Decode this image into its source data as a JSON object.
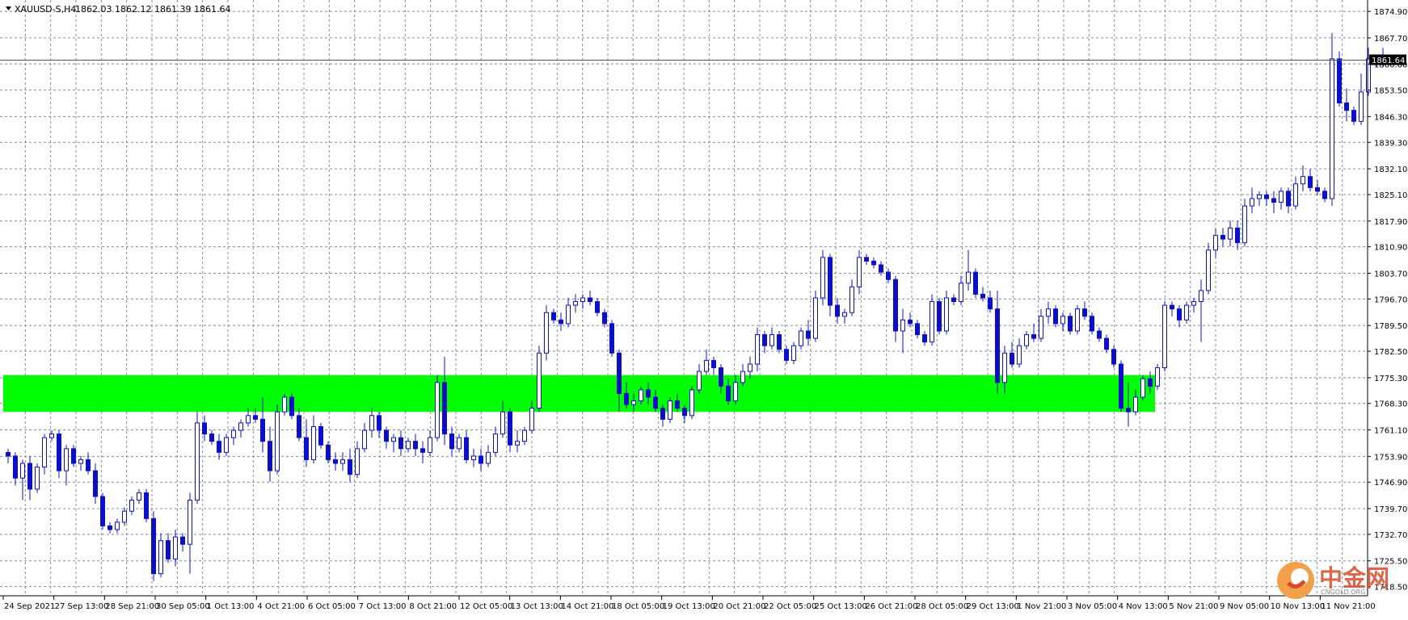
{
  "chart_header": {
    "symbol": "XAUUSD-S,H4",
    "ohlc": "1862.03 1862.12 1861.39 1861.64"
  },
  "price_axis": {
    "labels": [
      "1874.90",
      "1867.70",
      "1860.60",
      "1853.50",
      "1846.30",
      "1839.30",
      "1832.10",
      "1825.10",
      "1817.90",
      "1810.90",
      "1803.70",
      "1796.70",
      "1789.50",
      "1782.50",
      "1775.30",
      "1768.30",
      "1761.10",
      "1753.90",
      "1746.90",
      "1739.70",
      "1732.70",
      "1725.50",
      "1718.50"
    ],
    "current_price": "1861.64"
  },
  "time_axis": {
    "labels": [
      "24 Sep 2021",
      "27 Sep 13:00",
      "28 Sep 21:00",
      "30 Sep 05:00",
      "1 Oct 13:00",
      "4 Oct 21:00",
      "6 Oct 05:00",
      "7 Oct 13:00",
      "8 Oct 21:00",
      "12 Oct 05:00",
      "13 Oct 13:00",
      "14 Oct 21:00",
      "18 Oct 05:00",
      "19 Oct 13:00",
      "20 Oct 21:00",
      "22 Oct 05:00",
      "25 Oct 13:00",
      "26 Oct 21:00",
      "28 Oct 05:00",
      "29 Oct 13:00",
      "1 Nov 21:00",
      "3 Nov 05:00",
      "4 Nov 13:00",
      "5 Nov 21:00",
      "9 Nov 05:00",
      "10 Nov 13:00",
      "11 Nov 21:00"
    ]
  },
  "watermark": {
    "brand": "中金网",
    "url": "CNGOLD.ORG"
  },
  "colors": {
    "background": "#ffffff",
    "candle": "#0b10c8",
    "grid": "#7f8ca0",
    "zone": "#00ff00",
    "axis_text": "#000000",
    "watermark_orange": "#f2a14a",
    "watermark_red": "#d64a2c"
  },
  "chart_data": {
    "type": "candlestick",
    "symbol": "XAUUSD-S",
    "timeframe": "H4",
    "ylim": [
      1716,
      1878
    ],
    "highlight_zone": [
      1766,
      1776
    ],
    "ohlc": [
      [
        1755,
        1756,
        1752,
        1754
      ],
      [
        1754,
        1755,
        1746,
        1748
      ],
      [
        1748,
        1753,
        1742,
        1752
      ],
      [
        1752,
        1754,
        1742,
        1745
      ],
      [
        1745,
        1752,
        1744,
        1751
      ],
      [
        1751,
        1760,
        1749,
        1759
      ],
      [
        1759,
        1761,
        1758,
        1760
      ],
      [
        1760,
        1761,
        1748,
        1750
      ],
      [
        1750,
        1757,
        1746,
        1756
      ],
      [
        1756,
        1757,
        1751,
        1752
      ],
      [
        1752,
        1754,
        1750,
        1753
      ],
      [
        1753,
        1755,
        1749,
        1750
      ],
      [
        1750,
        1752,
        1741,
        1743
      ],
      [
        1743,
        1744,
        1734,
        1735
      ],
      [
        1735,
        1736,
        1733,
        1734
      ],
      [
        1734,
        1737,
        1733,
        1736
      ],
      [
        1736,
        1740,
        1735,
        1739
      ],
      [
        1739,
        1743,
        1738,
        1742
      ],
      [
        1742,
        1745,
        1741,
        1744
      ],
      [
        1744,
        1745,
        1736,
        1737
      ],
      [
        1737,
        1739,
        1720,
        1722
      ],
      [
        1722,
        1733,
        1721,
        1731
      ],
      [
        1731,
        1733,
        1725,
        1726
      ],
      [
        1726,
        1734,
        1724,
        1732
      ],
      [
        1732,
        1733,
        1728,
        1730
      ],
      [
        1730,
        1744,
        1722,
        1742
      ],
      [
        1742,
        1766,
        1741,
        1763
      ],
      [
        1763,
        1765,
        1758,
        1760
      ],
      [
        1760,
        1761,
        1757,
        1758
      ],
      [
        1758,
        1760,
        1753,
        1755
      ],
      [
        1755,
        1760,
        1754,
        1759
      ],
      [
        1759,
        1762,
        1757,
        1761
      ],
      [
        1761,
        1764,
        1759,
        1763
      ],
      [
        1763,
        1767,
        1762,
        1765
      ],
      [
        1765,
        1767,
        1763,
        1764
      ],
      [
        1764,
        1770,
        1755,
        1758
      ],
      [
        1758,
        1762,
        1747,
        1750
      ],
      [
        1750,
        1768,
        1749,
        1766
      ],
      [
        1766,
        1771,
        1765,
        1770
      ],
      [
        1770,
        1771,
        1764,
        1765
      ],
      [
        1765,
        1767,
        1758,
        1759
      ],
      [
        1759,
        1764,
        1751,
        1753
      ],
      [
        1753,
        1765,
        1752,
        1762
      ],
      [
        1762,
        1763,
        1756,
        1757
      ],
      [
        1757,
        1758,
        1752,
        1753
      ],
      [
        1753,
        1755,
        1750,
        1752
      ],
      [
        1752,
        1755,
        1750,
        1753
      ],
      [
        1753,
        1756,
        1747,
        1749
      ],
      [
        1749,
        1758,
        1748,
        1756
      ],
      [
        1756,
        1763,
        1755,
        1761
      ],
      [
        1761,
        1767,
        1759,
        1765
      ],
      [
        1765,
        1766,
        1759,
        1761
      ],
      [
        1761,
        1762,
        1756,
        1758
      ],
      [
        1758,
        1760,
        1755,
        1759
      ],
      [
        1759,
        1761,
        1754,
        1756
      ],
      [
        1756,
        1759,
        1755,
        1758
      ],
      [
        1758,
        1760,
        1754,
        1756
      ],
      [
        1756,
        1758,
        1752,
        1755
      ],
      [
        1755,
        1761,
        1754,
        1759
      ],
      [
        1759,
        1776,
        1758,
        1774
      ],
      [
        1774,
        1781,
        1757,
        1760
      ],
      [
        1760,
        1762,
        1754,
        1756
      ],
      [
        1756,
        1760,
        1755,
        1759
      ],
      [
        1759,
        1761,
        1752,
        1753
      ],
      [
        1753,
        1756,
        1751,
        1754
      ],
      [
        1754,
        1756,
        1750,
        1752
      ],
      [
        1752,
        1757,
        1751,
        1755
      ],
      [
        1755,
        1762,
        1754,
        1760
      ],
      [
        1760,
        1769,
        1759,
        1766
      ],
      [
        1766,
        1767,
        1755,
        1757
      ],
      [
        1757,
        1761,
        1755,
        1758
      ],
      [
        1758,
        1762,
        1757,
        1761
      ],
      [
        1761,
        1769,
        1760,
        1767
      ],
      [
        1767,
        1784,
        1766,
        1782
      ],
      [
        1782,
        1795,
        1780,
        1793
      ],
      [
        1793,
        1794,
        1790,
        1791
      ],
      [
        1791,
        1793,
        1788,
        1790
      ],
      [
        1790,
        1797,
        1789,
        1795
      ],
      [
        1795,
        1798,
        1793,
        1796
      ],
      [
        1796,
        1798,
        1794,
        1797
      ],
      [
        1797,
        1799,
        1795,
        1796
      ],
      [
        1796,
        1797,
        1792,
        1793
      ],
      [
        1793,
        1794,
        1789,
        1790
      ],
      [
        1790,
        1791,
        1781,
        1782
      ],
      [
        1782,
        1783,
        1766,
        1771
      ],
      [
        1771,
        1774,
        1767,
        1768
      ],
      [
        1768,
        1771,
        1766,
        1769
      ],
      [
        1769,
        1773,
        1768,
        1772
      ],
      [
        1772,
        1774,
        1768,
        1770
      ],
      [
        1770,
        1772,
        1766,
        1767
      ],
      [
        1767,
        1768,
        1762,
        1764
      ],
      [
        1764,
        1770,
        1763,
        1769
      ],
      [
        1769,
        1771,
        1766,
        1767
      ],
      [
        1767,
        1768,
        1763,
        1765
      ],
      [
        1765,
        1773,
        1764,
        1772
      ],
      [
        1772,
        1779,
        1771,
        1777
      ],
      [
        1777,
        1783,
        1776,
        1780
      ],
      [
        1780,
        1781,
        1776,
        1778
      ],
      [
        1778,
        1779,
        1771,
        1773
      ],
      [
        1773,
        1775,
        1768,
        1769
      ],
      [
        1769,
        1776,
        1768,
        1774
      ],
      [
        1774,
        1779,
        1773,
        1777
      ],
      [
        1777,
        1781,
        1775,
        1779
      ],
      [
        1779,
        1789,
        1777,
        1787
      ],
      [
        1787,
        1788,
        1782,
        1784
      ],
      [
        1784,
        1789,
        1783,
        1787
      ],
      [
        1787,
        1788,
        1782,
        1783
      ],
      [
        1783,
        1784,
        1779,
        1780
      ],
      [
        1780,
        1785,
        1779,
        1784
      ],
      [
        1784,
        1789,
        1783,
        1788
      ],
      [
        1788,
        1791,
        1784,
        1786
      ],
      [
        1786,
        1799,
        1785,
        1797
      ],
      [
        1797,
        1810,
        1795,
        1808
      ],
      [
        1808,
        1809,
        1792,
        1795
      ],
      [
        1795,
        1797,
        1790,
        1792
      ],
      [
        1792,
        1794,
        1790,
        1793
      ],
      [
        1793,
        1802,
        1792,
        1800
      ],
      [
        1800,
        1810,
        1798,
        1808
      ],
      [
        1808,
        1809,
        1806,
        1807
      ],
      [
        1807,
        1808,
        1805,
        1806
      ],
      [
        1806,
        1807,
        1803,
        1804
      ],
      [
        1804,
        1805,
        1801,
        1802
      ],
      [
        1802,
        1803,
        1785,
        1788
      ],
      [
        1788,
        1794,
        1782,
        1791
      ],
      [
        1791,
        1793,
        1789,
        1790
      ],
      [
        1790,
        1791,
        1786,
        1787
      ],
      [
        1787,
        1788,
        1784,
        1785
      ],
      [
        1785,
        1798,
        1784,
        1796
      ],
      [
        1796,
        1797,
        1787,
        1788
      ],
      [
        1788,
        1799,
        1787,
        1797
      ],
      [
        1797,
        1798,
        1795,
        1796
      ],
      [
        1796,
        1803,
        1795,
        1801
      ],
      [
        1801,
        1810,
        1799,
        1804
      ],
      [
        1804,
        1805,
        1797,
        1798
      ],
      [
        1798,
        1800,
        1796,
        1797
      ],
      [
        1797,
        1799,
        1793,
        1794
      ],
      [
        1794,
        1799,
        1771,
        1774
      ],
      [
        1774,
        1784,
        1771,
        1782
      ],
      [
        1782,
        1785,
        1778,
        1779
      ],
      [
        1779,
        1786,
        1778,
        1784
      ],
      [
        1784,
        1788,
        1783,
        1787
      ],
      [
        1787,
        1790,
        1785,
        1786
      ],
      [
        1786,
        1794,
        1785,
        1792
      ],
      [
        1792,
        1796,
        1790,
        1794
      ],
      [
        1794,
        1795,
        1789,
        1790
      ],
      [
        1790,
        1793,
        1788,
        1792
      ],
      [
        1792,
        1793,
        1787,
        1788
      ],
      [
        1788,
        1795,
        1787,
        1794
      ],
      [
        1794,
        1796,
        1791,
        1792
      ],
      [
        1792,
        1793,
        1787,
        1788
      ],
      [
        1788,
        1789,
        1785,
        1786
      ],
      [
        1786,
        1787,
        1782,
        1783
      ],
      [
        1783,
        1784,
        1778,
        1779
      ],
      [
        1779,
        1780,
        1766,
        1767
      ],
      [
        1767,
        1774,
        1762,
        1766
      ],
      [
        1766,
        1772,
        1765,
        1770
      ],
      [
        1770,
        1776,
        1769,
        1775
      ],
      [
        1775,
        1777,
        1771,
        1773
      ],
      [
        1773,
        1779,
        1772,
        1778
      ],
      [
        1778,
        1796,
        1777,
        1795
      ],
      [
        1795,
        1796,
        1792,
        1794
      ],
      [
        1794,
        1795,
        1789,
        1791
      ],
      [
        1791,
        1796,
        1790,
        1795
      ],
      [
        1795,
        1797,
        1793,
        1796
      ],
      [
        1796,
        1802,
        1785,
        1799
      ],
      [
        1799,
        1812,
        1798,
        1810
      ],
      [
        1810,
        1816,
        1808,
        1814
      ],
      [
        1814,
        1816,
        1811,
        1813
      ],
      [
        1813,
        1818,
        1811,
        1816
      ],
      [
        1816,
        1818,
        1810,
        1812
      ],
      [
        1812,
        1824,
        1811,
        1822
      ],
      [
        1822,
        1827,
        1820,
        1824
      ],
      [
        1824,
        1826,
        1822,
        1825
      ],
      [
        1825,
        1826,
        1822,
        1824
      ],
      [
        1824,
        1826,
        1820,
        1823
      ],
      [
        1823,
        1827,
        1821,
        1826
      ],
      [
        1826,
        1827,
        1820,
        1822
      ],
      [
        1822,
        1830,
        1821,
        1828
      ],
      [
        1828,
        1833,
        1826,
        1830
      ],
      [
        1830,
        1832,
        1826,
        1827
      ],
      [
        1827,
        1829,
        1825,
        1826
      ],
      [
        1826,
        1827,
        1823,
        1824
      ],
      [
        1824,
        1869,
        1822,
        1862
      ],
      [
        1862,
        1864,
        1849,
        1850
      ],
      [
        1850,
        1854,
        1845,
        1848
      ],
      [
        1848,
        1849,
        1844,
        1845
      ],
      [
        1845,
        1858,
        1844,
        1853
      ],
      [
        1853,
        1865,
        1852,
        1862
      ],
      [
        1862,
        1863,
        1860,
        1861
      ],
      [
        1861,
        1865,
        1860,
        1862
      ]
    ]
  }
}
